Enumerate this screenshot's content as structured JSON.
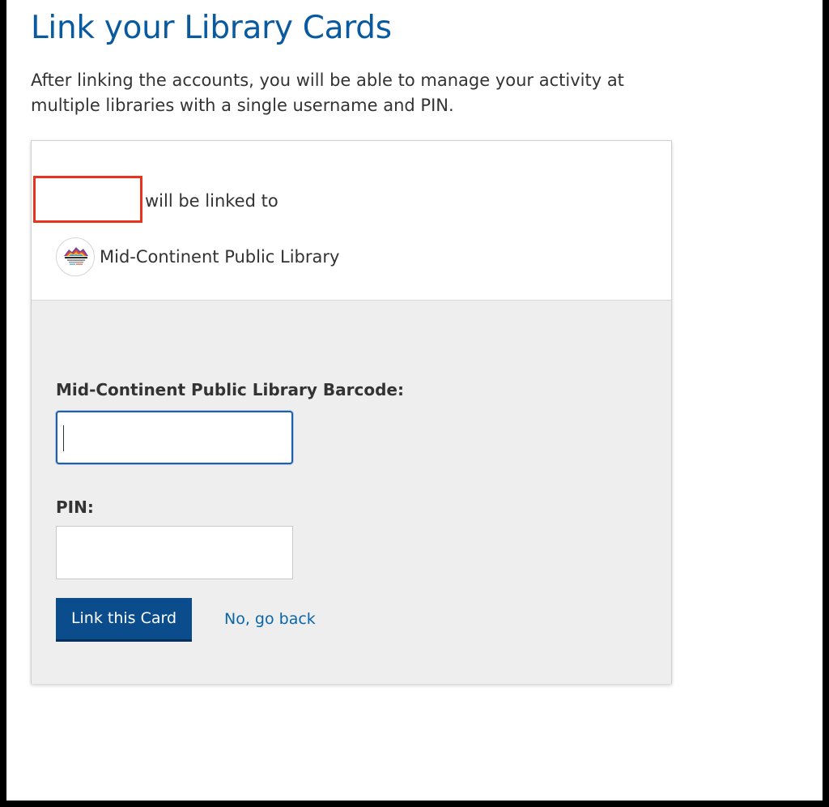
{
  "page": {
    "title": "Link your Library Cards",
    "intro": "After linking the accounts, you will be able to manage your activity at multiple libraries with a single username and PIN."
  },
  "link_info": {
    "linked_to_text": "will be linked to",
    "library_name": "Mid-Continent Public Library",
    "library_logo_icon": "mid-continent-public-library-logo"
  },
  "form": {
    "barcode_label": "Mid-Continent Public Library Barcode:",
    "barcode_value": "",
    "pin_label": "PIN:",
    "pin_value": "",
    "submit_label": "Link this Card",
    "back_label": "No, go back"
  },
  "colors": {
    "title": "#0a5aa0",
    "button": "#0b4d8c",
    "link": "#0a66a8",
    "redaction_border": "#e8341c",
    "form_background": "#eeeeee"
  }
}
